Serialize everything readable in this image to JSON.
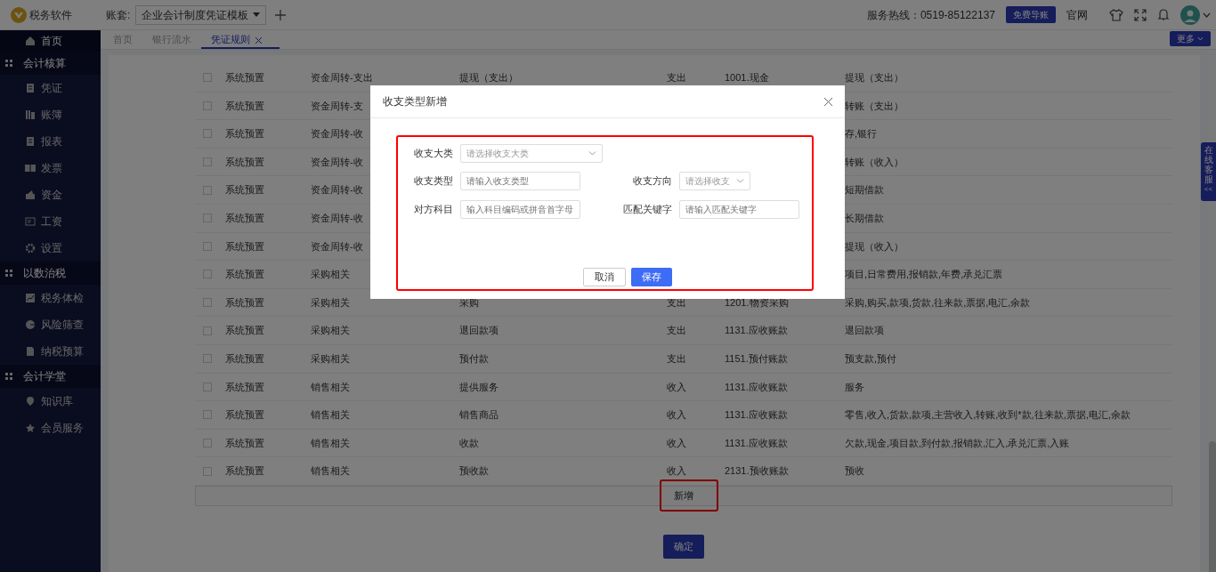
{
  "header": {
    "app_name": "税务软件",
    "ledger_label": "账套:",
    "ledger_select": "企业会计制度凭证模板",
    "hotline": "服务热线：0519-85122137",
    "import_button": "免费导账",
    "website_link": "官网"
  },
  "sidebar": [
    {
      "label": "首页",
      "kind": "item",
      "selected": true
    },
    {
      "label": "会计核算",
      "kind": "group",
      "children": [
        {
          "label": "凭证",
          "selected": false
        },
        {
          "label": "账簿",
          "selected": false
        },
        {
          "label": "报表",
          "selected": false
        },
        {
          "label": "发票",
          "selected": false
        },
        {
          "label": "资金",
          "selected": false
        },
        {
          "label": "工资",
          "selected": false
        },
        {
          "label": "设置",
          "selected": false
        }
      ]
    },
    {
      "label": "以数治税",
      "kind": "group",
      "children": [
        {
          "label": "税务体检",
          "selected": false
        },
        {
          "label": "风险筛查",
          "selected": false
        },
        {
          "label": "纳税预算",
          "selected": false
        }
      ]
    },
    {
      "label": "会计学堂",
      "kind": "group",
      "children": [
        {
          "label": "知识库",
          "selected": false
        },
        {
          "label": "会员服务",
          "selected": false
        }
      ]
    }
  ],
  "tabs": [
    {
      "label": "首页",
      "selected": false,
      "closable": false
    },
    {
      "label": "银行流水",
      "selected": false,
      "closable": false
    },
    {
      "label": "凭证规则",
      "selected": true,
      "closable": true
    }
  ],
  "more_button": "更多",
  "table": {
    "rows": [
      {
        "checked": false,
        "column_1": "系统预置",
        "column_2": "资金周转-支出",
        "column_3": "提现（支出）",
        "column_4": "支出",
        "column_5": "1001.现金",
        "column_6": "提现（支出）"
      },
      {
        "checked": false,
        "column_1": "系统预置",
        "column_2": "资金周转-支",
        "column_6": "转账（支出）"
      },
      {
        "checked": false,
        "column_1": "系统预置",
        "column_2": "资金周转-收",
        "column_6": "存,银行"
      },
      {
        "checked": false,
        "column_1": "系统预置",
        "column_2": "资金周转-收",
        "column_6": "转账（收入）"
      },
      {
        "checked": false,
        "column_1": "系统预置",
        "column_2": "资金周转-收",
        "column_6": "短期借款"
      },
      {
        "checked": false,
        "column_1": "系统预置",
        "column_2": "资金周转-收",
        "column_6": "长期借款"
      },
      {
        "checked": false,
        "column_1": "系统预置",
        "column_2": "资金周转-收",
        "column_6": "提现（收入）"
      },
      {
        "checked": false,
        "column_1": "系统预置",
        "column_2": "采购相关",
        "column_6": "项目,日常费用,报销款,年费,承兑汇票"
      },
      {
        "checked": false,
        "column_1": "系统预置",
        "column_2": "采购相关",
        "column_3": "采购",
        "column_4": "支出",
        "column_5": "1201.物资采购",
        "column_6": "采购,购买,款项,货款,往来款,票据,电汇,余款"
      },
      {
        "checked": false,
        "column_1": "系统预置",
        "column_2": "采购相关",
        "column_3": "退回款项",
        "column_4": "支出",
        "column_5": "1131.应收账款",
        "column_6": "退回款项"
      },
      {
        "checked": false,
        "column_1": "系统预置",
        "column_2": "采购相关",
        "column_3": "预付款",
        "column_4": "支出",
        "column_5": "1151.预付账款",
        "column_6": "预支款,预付"
      },
      {
        "checked": false,
        "column_1": "系统预置",
        "column_2": "销售相关",
        "column_3": "提供服务",
        "column_4": "收入",
        "column_5": "1131.应收账款",
        "column_6": "服务"
      },
      {
        "checked": false,
        "column_1": "系统预置",
        "column_2": "销售相关",
        "column_3": "销售商品",
        "column_4": "收入",
        "column_5": "1131.应收账款",
        "column_6": "零售,收入,货款,款项,主营收入,转账,收到*款,往来款,票据,电汇,余款"
      },
      {
        "checked": false,
        "column_1": "系统预置",
        "column_2": "销售相关",
        "column_3": "收款",
        "column_4": "收入",
        "column_5": "1131.应收账款",
        "column_6": "欠款,现金,项目款,到付款,报销款,汇入,承兑汇票,入账"
      },
      {
        "checked": false,
        "column_1": "系统预置",
        "column_2": "销售相关",
        "column_3": "预收款",
        "column_4": "收入",
        "column_5": "2131.预收账款",
        "column_6": "预收"
      }
    ],
    "add_button": "新增"
  },
  "confirm_button": "确定",
  "support_tab": {
    "label": "在线客服",
    "arrows": "<<"
  },
  "modal": {
    "title": "收支类型新增",
    "fields": [
      {
        "label": "收支大类",
        "kind": "select",
        "placeholder": "请选择收支大类"
      },
      {
        "label": "收支类型",
        "kind": "input",
        "placeholder": "请输入收支类型"
      },
      {
        "label": "收支方向",
        "kind": "select",
        "placeholder": "请选择收支"
      },
      {
        "label": "对方科目",
        "kind": "input",
        "placeholder": "输入科目编码或拼音首字母"
      },
      {
        "label": "匹配关键字",
        "kind": "input",
        "placeholder": "请输入匹配关键字"
      }
    ],
    "cancel_button": "取消",
    "save_button": "保存"
  }
}
